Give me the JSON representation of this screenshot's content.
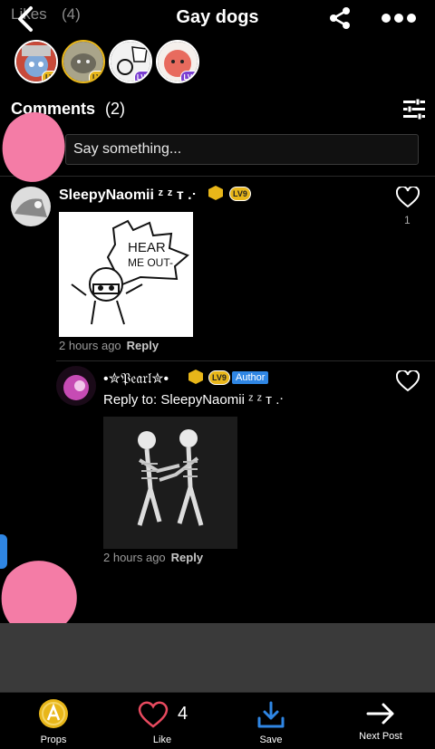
{
  "header": {
    "likes_label": "Likes",
    "likes_count": "(4)",
    "title": "Gay dogs",
    "likers": [
      {
        "level": "LV7",
        "bg": "#b84040",
        "level_color": "#e8b619"
      },
      {
        "level": "LV9",
        "bg": "#a9a48a",
        "level_color": "#e8b619"
      },
      {
        "level": "LV11",
        "bg": "#f2f2f2",
        "level_color": "#7b3fd1"
      },
      {
        "level": "LV10",
        "bg": "#e86b5e",
        "level_color": "#7b3fd1"
      }
    ]
  },
  "comments_section": {
    "title": "Comments",
    "count": "(2)",
    "input_placeholder": "Say something..."
  },
  "comments": [
    {
      "username": "SleepyNaomii ᶻ ᶻ ᴛ .ᐧ",
      "level": "LV9",
      "image_text_line1": "HEAR",
      "image_text_line2": "ME OUT-",
      "time": "2 hours ago",
      "reply_label": "Reply",
      "likes": "1"
    },
    {
      "username": "•✮𝔓𝔢𝔞𝔯𝔩✮•",
      "level": "LV9",
      "author_tag": "Author",
      "reply_to": "Reply to: SleepyNaomii ᶻ ᶻ ᴛ .ᐧ",
      "time": "2 hours ago",
      "reply_label": "Reply"
    }
  ],
  "bottom_bar": {
    "props_label": "Props",
    "like_label": "Like",
    "like_count": "4",
    "save_label": "Save",
    "next_label": "Next Post"
  },
  "colors": {
    "accent_blue": "#2f86e4",
    "heart_red": "#e84a5f",
    "gold": "#e8b619"
  }
}
